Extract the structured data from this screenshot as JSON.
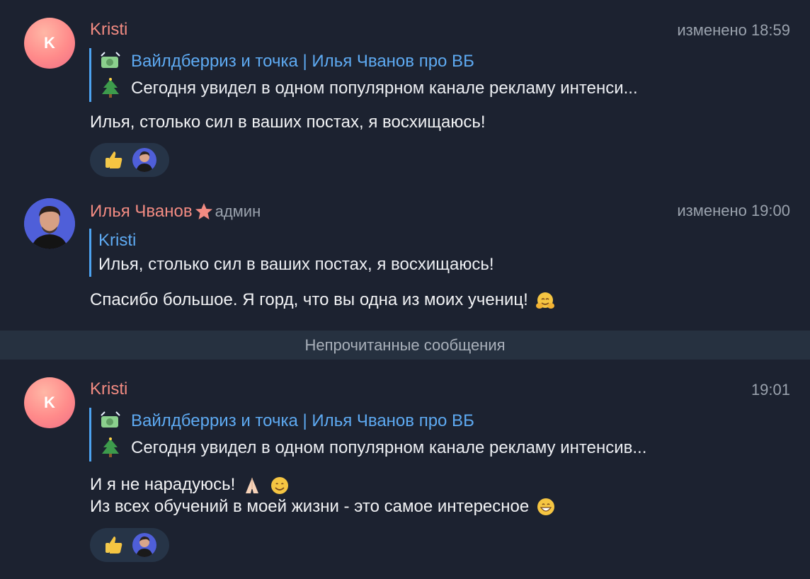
{
  "messages": [
    {
      "avatar_letter": "K",
      "author": "Kristi",
      "time": "изменено 18:59",
      "quote_title": "Вайлдберриз и точка | Илья Чванов про ВБ",
      "quote_text": "Сегодня увидел в одном популярном канале рекламу интенси...",
      "quote_title_icon": "money-icon",
      "quote_text_icon": "tree-icon",
      "body_lines": [
        "Илья, столько сил в ваших постах, я восхищаюсь!"
      ],
      "reactions": [
        "thumbs-up-icon",
        "reactor-avatar"
      ]
    },
    {
      "author": "Илья Чванов",
      "role": "админ",
      "time": "изменено 19:00",
      "quote_title": "Kristi",
      "quote_text": "Илья, столько сил в ваших постах, я восхищаюсь!",
      "body_lines": [
        "Спасибо большое. Я горд, что вы одна из моих учениц!"
      ],
      "body_icon": "hug-icon"
    },
    {
      "avatar_letter": "K",
      "author": "Kristi",
      "time": "19:01",
      "quote_title": "Вайлдберриз и точка | Илья Чванов про ВБ",
      "quote_text": "Сегодня увидел в одном популярном канале рекламу интенсив...",
      "quote_title_icon": "money-icon",
      "quote_text_icon": "tree-icon",
      "body_lines": [
        "И я не нарадуюсь!",
        "Из всех обучений в моей жизни - это самое интересное"
      ],
      "body_icons": [
        "pray-icon",
        "smile-icon",
        "grin-icon"
      ],
      "reactions": [
        "thumbs-up-icon",
        "reactor-avatar"
      ]
    }
  ],
  "divider_text": "Непрочитанные сообщения",
  "colors": {
    "background": "#1c2230",
    "author": "#f28b82",
    "link": "#5eaaf2",
    "quote_bar": "#4da3f0",
    "muted": "#9aa2ad"
  }
}
